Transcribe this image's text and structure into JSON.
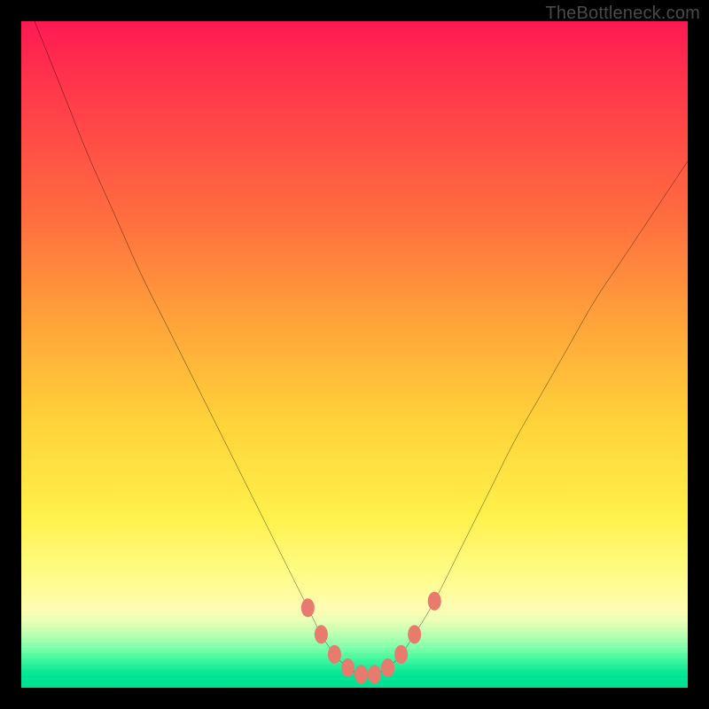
{
  "watermark": "TheBottleneck.com",
  "colors": {
    "frame": "#000000",
    "curve": "#000000",
    "marker": "#e77b6d",
    "gradient_top": "#ff1a52",
    "gradient_bottom": "#00e091"
  },
  "chart_data": {
    "type": "line",
    "title": "",
    "xlabel": "",
    "ylabel": "",
    "xlim": [
      0,
      100
    ],
    "ylim": [
      0,
      100
    ],
    "annotations": [],
    "series": [
      {
        "name": "bottleneck-curve",
        "x": [
          2,
          6,
          10,
          14,
          18,
          22,
          26,
          30,
          34,
          38,
          41,
          43,
          45,
          47,
          49,
          51,
          53,
          55,
          57,
          59,
          62,
          66,
          70,
          74,
          78,
          82,
          86,
          90,
          94,
          98,
          100
        ],
        "values": [
          100,
          90,
          80,
          71,
          62,
          54,
          46,
          38,
          30,
          22,
          16,
          12,
          8,
          5,
          3,
          2,
          2,
          3,
          5,
          8,
          13,
          21,
          29,
          37,
          44,
          51,
          58,
          64,
          70,
          76,
          79
        ]
      }
    ],
    "markers": [
      {
        "x": 43,
        "y": 12
      },
      {
        "x": 45,
        "y": 8
      },
      {
        "x": 47,
        "y": 5
      },
      {
        "x": 49,
        "y": 3
      },
      {
        "x": 51,
        "y": 2
      },
      {
        "x": 53,
        "y": 2
      },
      {
        "x": 55,
        "y": 3
      },
      {
        "x": 57,
        "y": 5
      },
      {
        "x": 59,
        "y": 8
      },
      {
        "x": 62,
        "y": 13
      }
    ],
    "background_bands": {
      "note": "vertical rainbow gradient, red top to green bottom, with fine banding near the green end",
      "stops": [
        {
          "pos": 0.0,
          "color": "#ff1a52"
        },
        {
          "pos": 0.3,
          "color": "#ff6f3f"
        },
        {
          "pos": 0.6,
          "color": "#ffd23a"
        },
        {
          "pos": 0.82,
          "color": "#fffb80"
        },
        {
          "pos": 0.92,
          "color": "#b8ffb1"
        },
        {
          "pos": 1.0,
          "color": "#00e091"
        }
      ]
    }
  }
}
